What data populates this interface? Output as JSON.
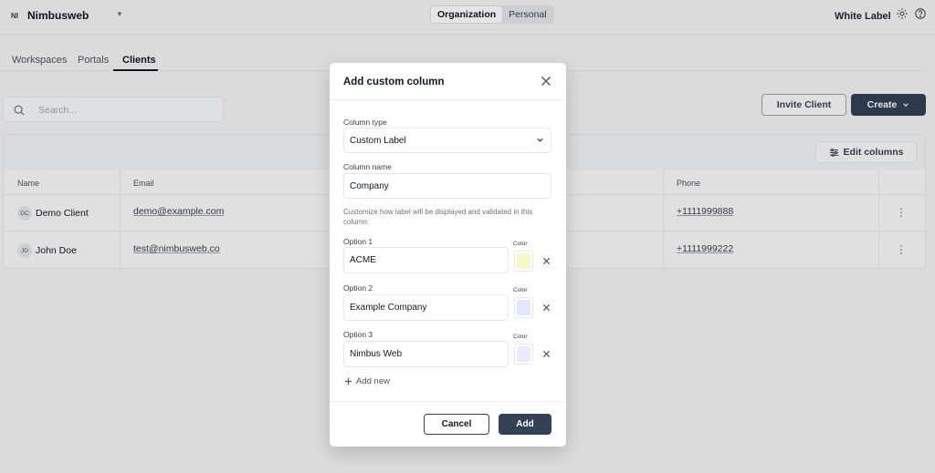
{
  "workspace": {
    "initials": "NI",
    "name": "Nimbusweb"
  },
  "context_switch": [
    "Organization",
    "Personal"
  ],
  "header": {
    "white_label": "White Label"
  },
  "tabs": [
    "Workspaces",
    "Portals",
    "Clients"
  ],
  "search": {
    "placeholder": "Search..."
  },
  "actions": {
    "invite": "Invite Client",
    "create": "Create",
    "edit_columns": "Edit columns"
  },
  "table": {
    "columns": [
      "Name",
      "Email",
      "Phone"
    ],
    "rows": [
      {
        "initials": "DC",
        "name": "Demo Client",
        "email": "demo@example.com",
        "phone": "+1111999888"
      },
      {
        "initials": "JD",
        "name": "John Doe",
        "email": "test@nimbusweb.co",
        "phone": "+1111999222"
      }
    ]
  },
  "modal": {
    "title": "Add custom column",
    "column_type_label": "Column type",
    "column_type_value": "Custom Label",
    "column_name_label": "Column name",
    "column_name_value": "Company",
    "help_text": "Customize how label will be displayed and validated in this column:",
    "color_label": "Color",
    "options": [
      {
        "label": "Option 1",
        "value": "ACME",
        "color": "#f5f9c8"
      },
      {
        "label": "Option 2",
        "value": "Example Company",
        "color": "#e0e7ff"
      },
      {
        "label": "Option 3",
        "value": "Nimbus Web",
        "color": "#f0e9fd"
      }
    ],
    "add_new": "Add new",
    "cancel": "Cancel",
    "add": "Add"
  }
}
